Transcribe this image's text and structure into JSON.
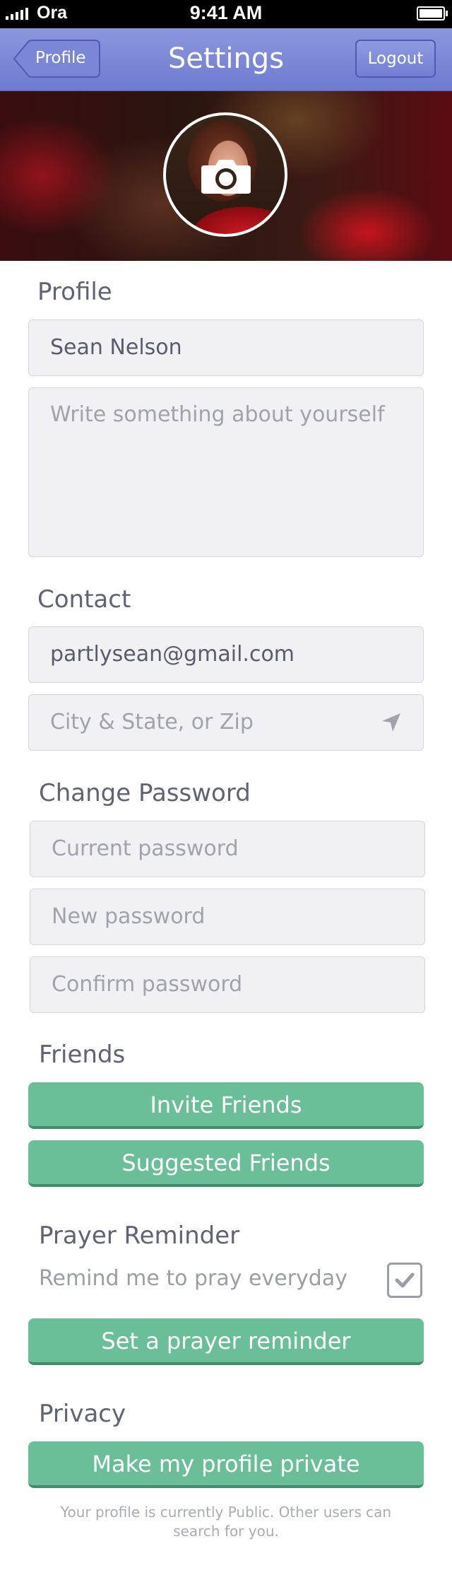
{
  "status_bar": {
    "carrier": "Ora",
    "time": "9:41 AM"
  },
  "navbar": {
    "title": "Settings",
    "back_label": "Profile",
    "logout_label": "Logout",
    "accent": "#7b87d6"
  },
  "profile": {
    "heading": "Profile",
    "name_value": "Sean Nelson",
    "bio_placeholder": "Write something about yourself"
  },
  "contact": {
    "heading": "Contact",
    "email_value": "partlysean@gmail.com",
    "location_placeholder": "City & State, or Zip"
  },
  "password": {
    "heading": "Change Password",
    "current_placeholder": "Current password",
    "new_placeholder": "New password",
    "confirm_placeholder": "Confirm password"
  },
  "friends": {
    "heading": "Friends",
    "invite_label": "Invite Friends",
    "suggested_label": "Suggested Friends"
  },
  "prayer": {
    "heading": "Prayer Reminder",
    "remind_label": "Remind me to pray everyday",
    "remind_checked": true,
    "set_label": "Set a prayer reminder"
  },
  "privacy": {
    "heading": "Privacy",
    "private_label": "Make my profile private",
    "note": "Your profile is currently Public. Other users can search for you."
  },
  "colors": {
    "button_green": "#6bbf98",
    "field_bg": "#f1f1f3"
  },
  "icons": {
    "camera": "camera-icon",
    "location": "location-arrow-icon",
    "check": "checkmark-icon",
    "back": "back-chevron-icon"
  }
}
